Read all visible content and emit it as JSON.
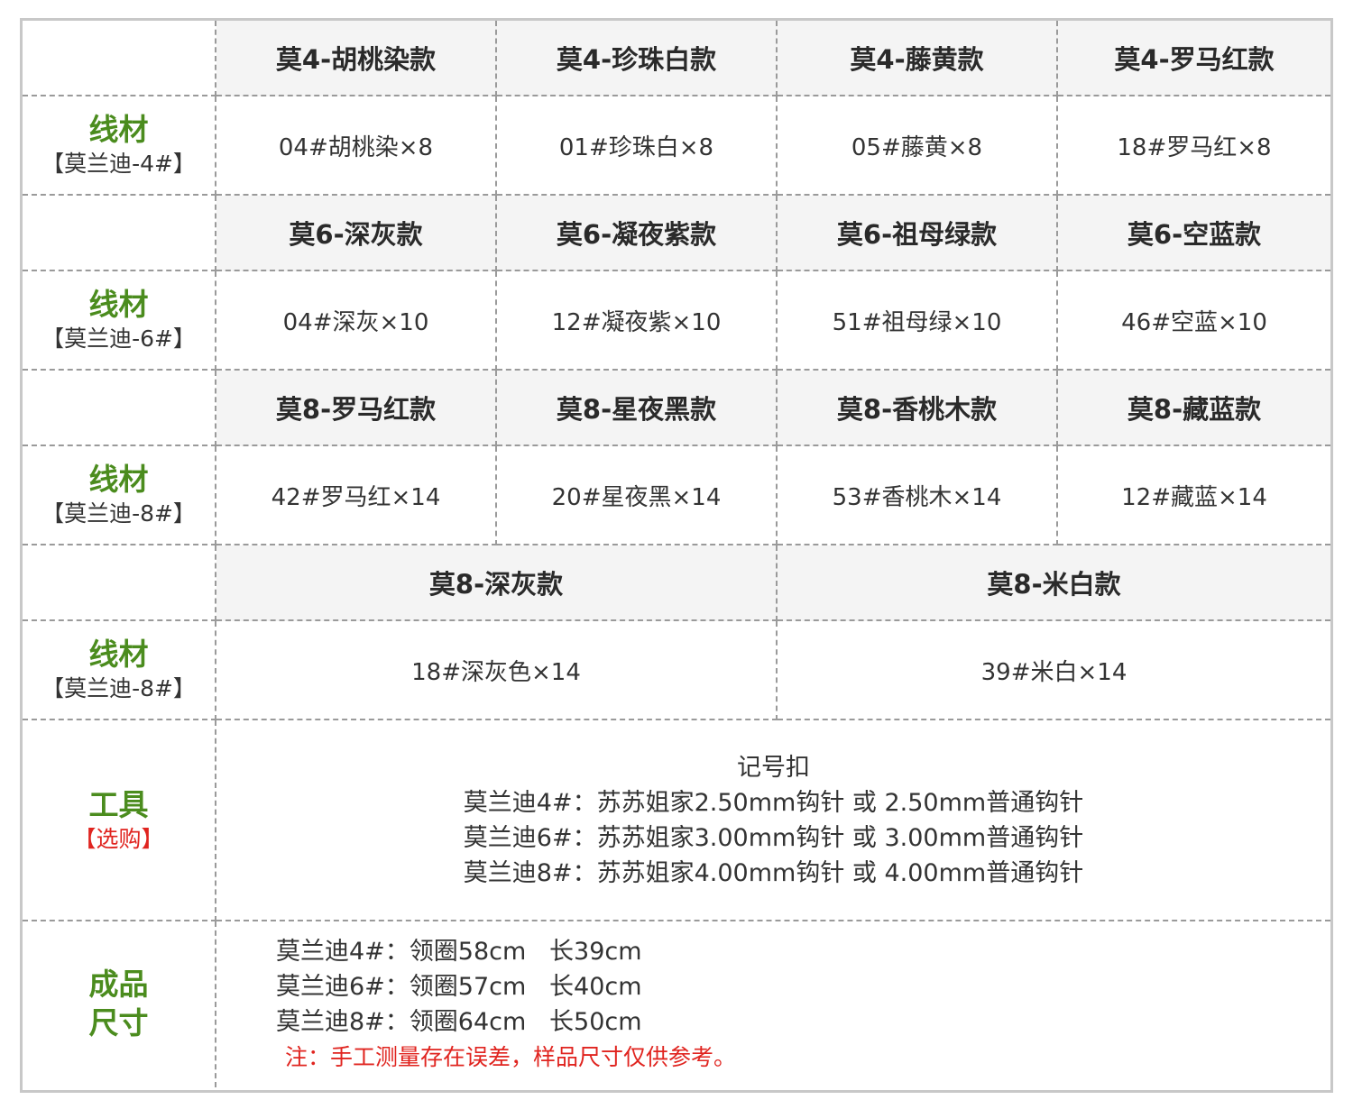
{
  "headers_row1": [
    "莫4-胡桃染款",
    "莫4-珍珠白款",
    "莫4-藤黄款",
    "莫4-罗马红款"
  ],
  "values_row1": [
    "04#胡桃染×8",
    "01#珍珠白×8",
    "05#藤黄×8",
    "18#罗马红×8"
  ],
  "label_row1": {
    "title": "线材",
    "sub": "【莫兰迪-4#】"
  },
  "headers_row2": [
    "莫6-深灰款",
    "莫6-凝夜紫款",
    "莫6-祖母绿款",
    "莫6-空蓝款"
  ],
  "values_row2": [
    "04#深灰×10",
    "12#凝夜紫×10",
    "51#祖母绿×10",
    "46#空蓝×10"
  ],
  "label_row2": {
    "title": "线材",
    "sub": "【莫兰迪-6#】"
  },
  "headers_row3": [
    "莫8-罗马红款",
    "莫8-星夜黑款",
    "莫8-香桃木款",
    "莫8-藏蓝款"
  ],
  "values_row3": [
    "42#罗马红×14",
    "20#星夜黑×14",
    "53#香桃木×14",
    "12#藏蓝×14"
  ],
  "label_row3": {
    "title": "线材",
    "sub": "【莫兰迪-8#】"
  },
  "headers_row4": [
    "莫8-深灰款",
    "莫8-米白款"
  ],
  "values_row4": [
    "18#深灰色×14",
    "39#米白×14"
  ],
  "label_row4": {
    "title": "线材",
    "sub": "【莫兰迪-8#】"
  },
  "tools": {
    "title": "工具",
    "sub": "【选购】",
    "lines": [
      "记号扣",
      "莫兰迪4#：苏苏姐家2.50mm钩针 或 2.50mm普通钩针",
      "莫兰迪6#：苏苏姐家3.00mm钩针 或 3.00mm普通钩针",
      "莫兰迪8#：苏苏姐家4.00mm钩针 或 4.00mm普通钩针"
    ]
  },
  "sizes": {
    "title_line1": "成品",
    "title_line2": "尺寸",
    "lines": [
      "莫兰迪4#：领圈58cm   长39cm",
      "莫兰迪6#：领圈57cm   长40cm",
      "莫兰迪8#：领圈64cm   长50cm"
    ],
    "note": "注：手工测量存在误差，样品尺寸仅供参考。"
  },
  "colors": {
    "label_green": "#4b8c1e",
    "note_red": "#e0241f",
    "header_bg": "#f4f4f4",
    "border": "#9a9a9a"
  }
}
